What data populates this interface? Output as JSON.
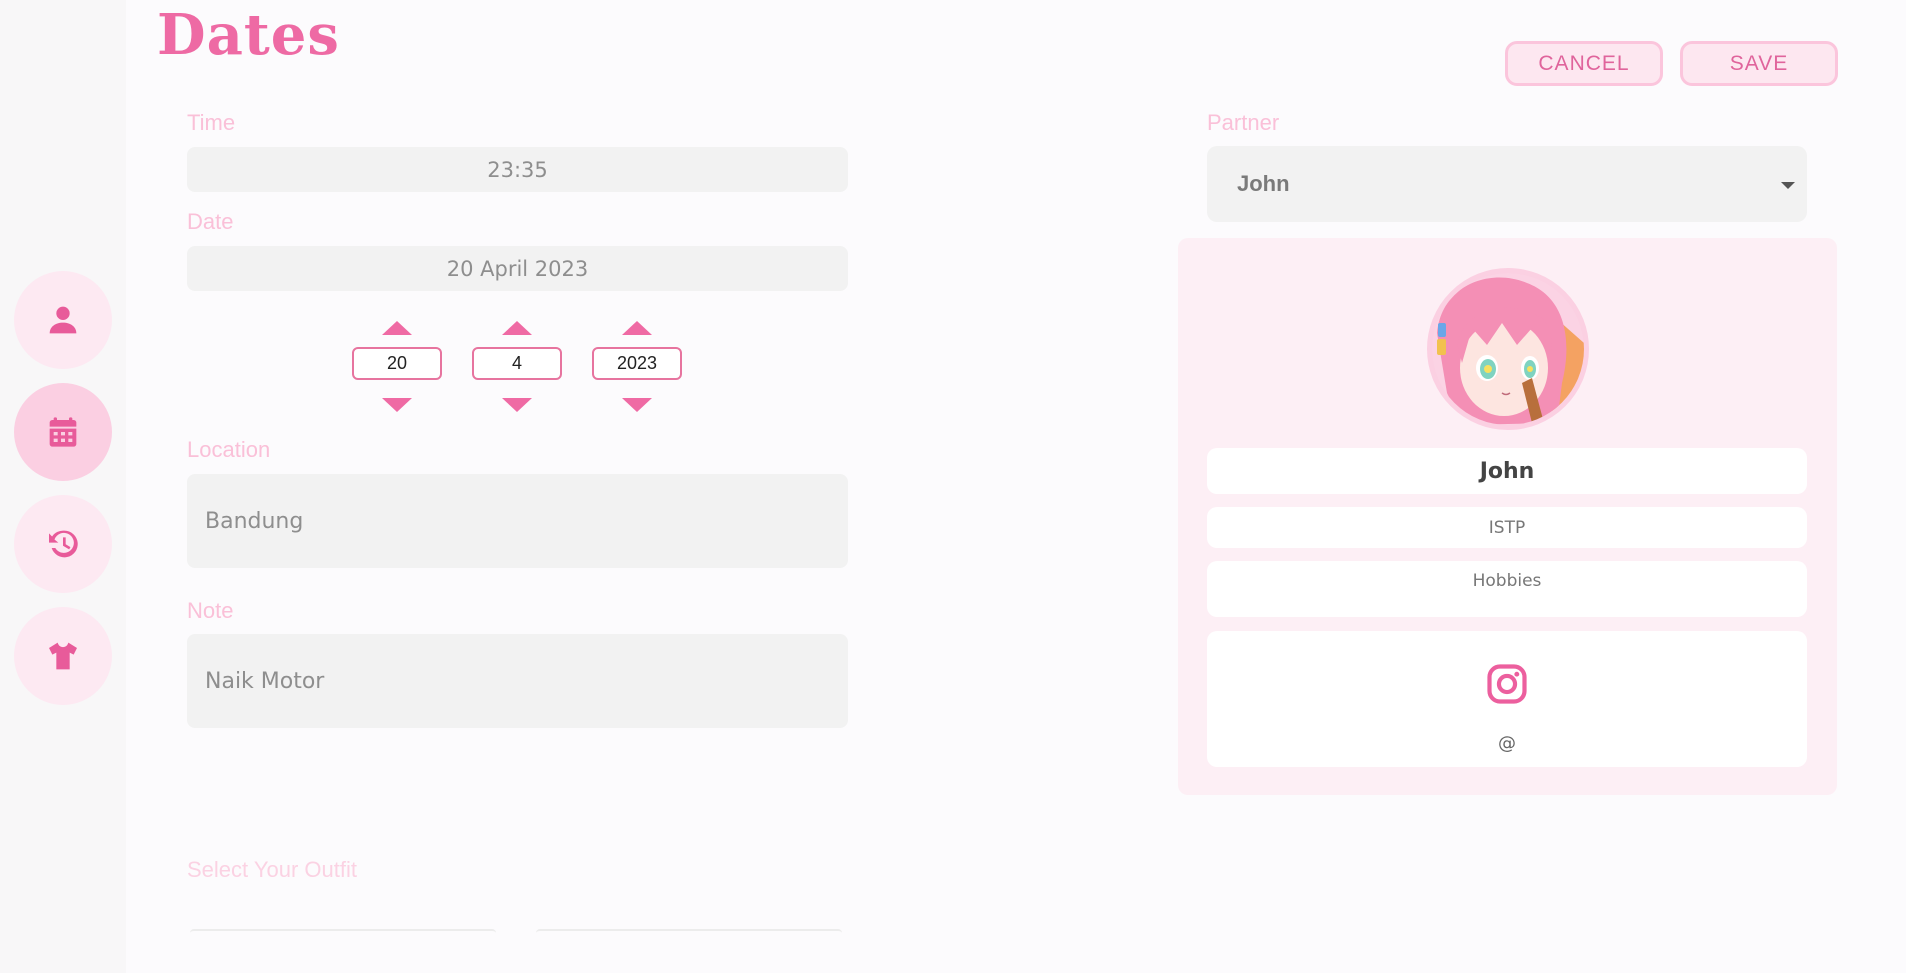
{
  "page": {
    "title": "Dates",
    "cancel_label": "CANCEL",
    "save_label": "SAVE"
  },
  "sidebar": {
    "items": [
      {
        "icon": "user-icon",
        "active": false
      },
      {
        "icon": "calendar-icon",
        "active": true
      },
      {
        "icon": "history-icon",
        "active": false
      },
      {
        "icon": "shirt-icon",
        "active": false
      }
    ]
  },
  "form": {
    "time_label": "Time",
    "time_value": "23:35",
    "date_label": "Date",
    "date_value": "20 April 2023",
    "day": "20",
    "month": "4",
    "year": "2023",
    "location_label": "Location",
    "location_value": "Bandung",
    "note_label": "Note",
    "note_value": "Naik Motor",
    "outfit_label": "Select Your Outfit"
  },
  "partner": {
    "label": "Partner",
    "selected": "John",
    "name": "John",
    "mbti": "ISTP",
    "hobbies_placeholder": "Hobbies",
    "instagram_handle": "@",
    "instagram_icon": "instagram-icon"
  },
  "colors": {
    "accent": "#ee6aa4",
    "label": "#fac0d8",
    "field": "#f2f2f2",
    "card": "#fdeff5"
  }
}
